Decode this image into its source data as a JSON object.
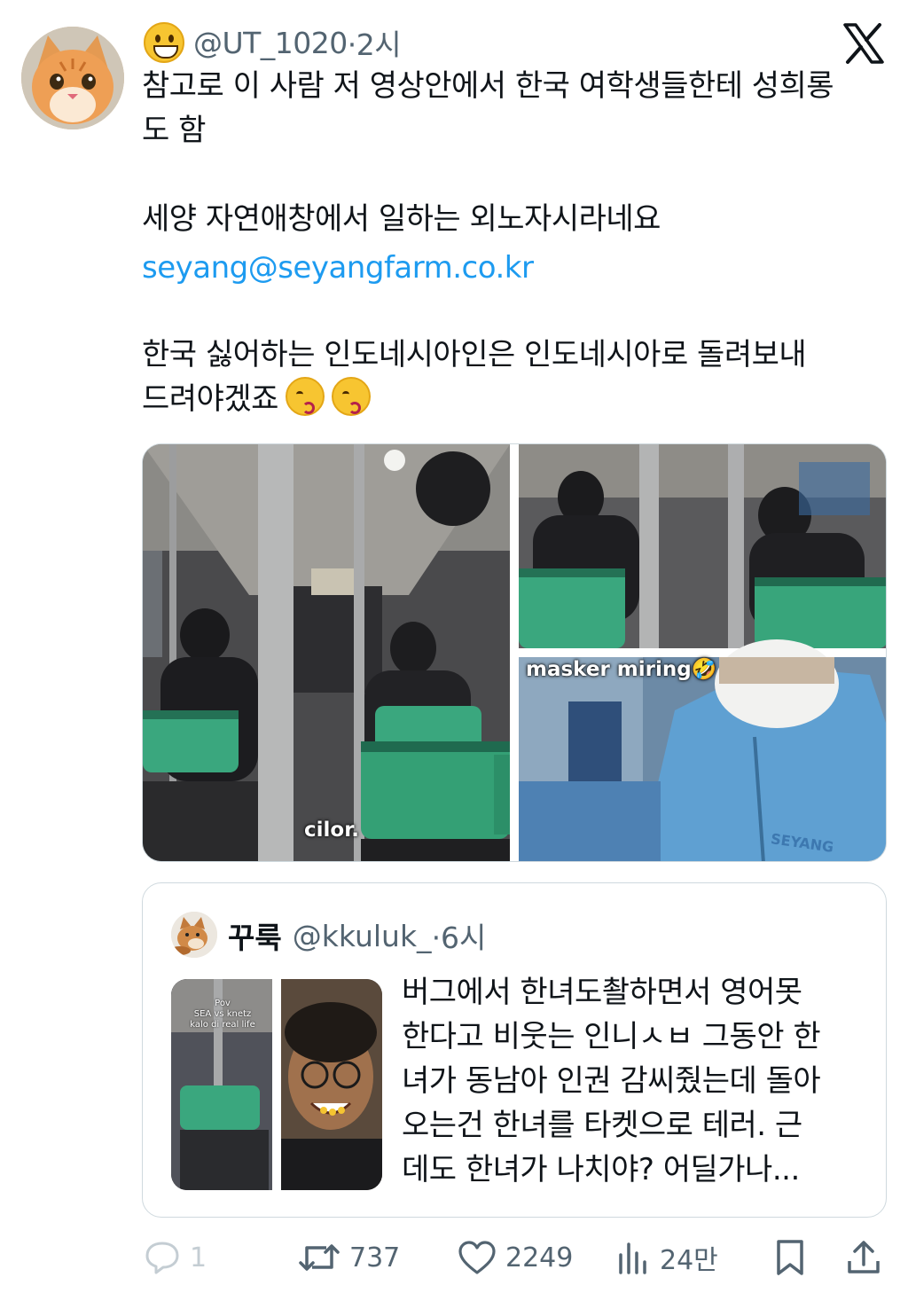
{
  "tweet": {
    "handle": "@UT_1020",
    "time": "·2시",
    "lines": [
      "참고로 이 사람 저 영상안에서 한국 여학생들한테 성희롱",
      "도 함",
      "세양 자연애창에서 일하는 외노자시라네요",
      "seyang@seyangfarm.co.kr",
      "한국 싫어하는 인도네시아인은 인도네시아로 돌려보내",
      "드려야겠죠"
    ],
    "emoji_after_last_line": [
      "kissing-face",
      "kissing-face"
    ],
    "media_captions": {
      "left_video": "cilor.",
      "bottom_right": "masker miring🤣",
      "jacket_print": "SEYANG"
    }
  },
  "quote": {
    "display_name": "꾸룩",
    "handle": "@kkuluk_",
    "time": "·6시",
    "lines": [
      "버그에서 한녀도촬하면서 영어못",
      "한다고 비웃는 인니ㅅㅂ 그동안 한",
      "녀가 동남아 인권 감씨줬는데 돌아",
      "오는건 한녀를 타켓으로 테러. 근",
      "데도 한녀가 나치야? 어딜가나..."
    ],
    "thumb_caption": [
      "Pov",
      "SEA vs knetz",
      "kalo di real life"
    ]
  },
  "actions": {
    "replies": "1",
    "reposts": "737",
    "likes": "2249",
    "views": "24만"
  },
  "colors": {
    "link": "#1d9bf0",
    "muted": "#536471",
    "border": "#cfd9de",
    "seat_green": "#3aa77e"
  }
}
